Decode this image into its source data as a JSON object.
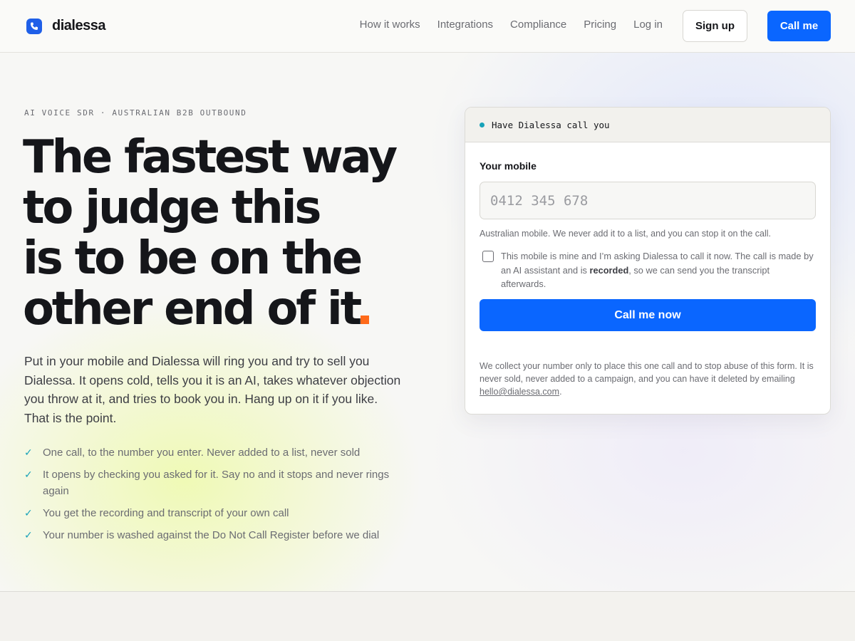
{
  "brand": {
    "name": "dialessa",
    "logo_icon": "phone-logo-icon",
    "accent": "#0a66ff",
    "highlight": "#ff6a1a",
    "check_color": "#17a2b8"
  },
  "nav": {
    "items": [
      "How it works",
      "Integrations",
      "Compliance",
      "Pricing",
      "Log in"
    ],
    "signup_label": "Sign up",
    "callme_label": "Call me"
  },
  "hero": {
    "eyebrow": "AI VOICE SDR · AUSTRALIAN B2B OUTBOUND",
    "headline_lines": [
      "The fastest way",
      "to judge this",
      "is to be on the",
      "other end of it"
    ],
    "lead": "Put in your mobile and Dialessa will ring you and try to sell you Dialessa. It opens cold, tells you it is an AI, takes whatever objection you throw at it, and tries to book you in. Hang up on it if you like. That is the point.",
    "checks": [
      "One call, to the number you enter. Never added to a list, never sold",
      "It opens by checking you asked for it. Say no and it stops and never rings again",
      "You get the recording and transcript of your own call",
      "Your number is washed against the Do Not Call Register before we dial"
    ],
    "check_icon": "check-icon"
  },
  "form": {
    "title": "Have Dialessa call you",
    "mobile_label": "Your mobile",
    "mobile_placeholder": "0412 345 678",
    "mobile_value": "",
    "hint": "Australian mobile. We never add it to a list, and you can stop it on the call.",
    "consent_before": "This mobile is mine and I’m asking Dialessa to call it now. The call is made by an AI assistant and is ",
    "consent_bold": "recorded",
    "consent_after": ", so we can send you the transcript afterwards.",
    "consent_checked": false,
    "submit_label": "Call me now",
    "privacy_text": "We collect your number only to place this one call and to stop abuse of this form. It is never sold, never added to a campaign, and you can have it deleted by emailing ",
    "privacy_email": "hello@dialessa.com",
    "privacy_end": "."
  }
}
